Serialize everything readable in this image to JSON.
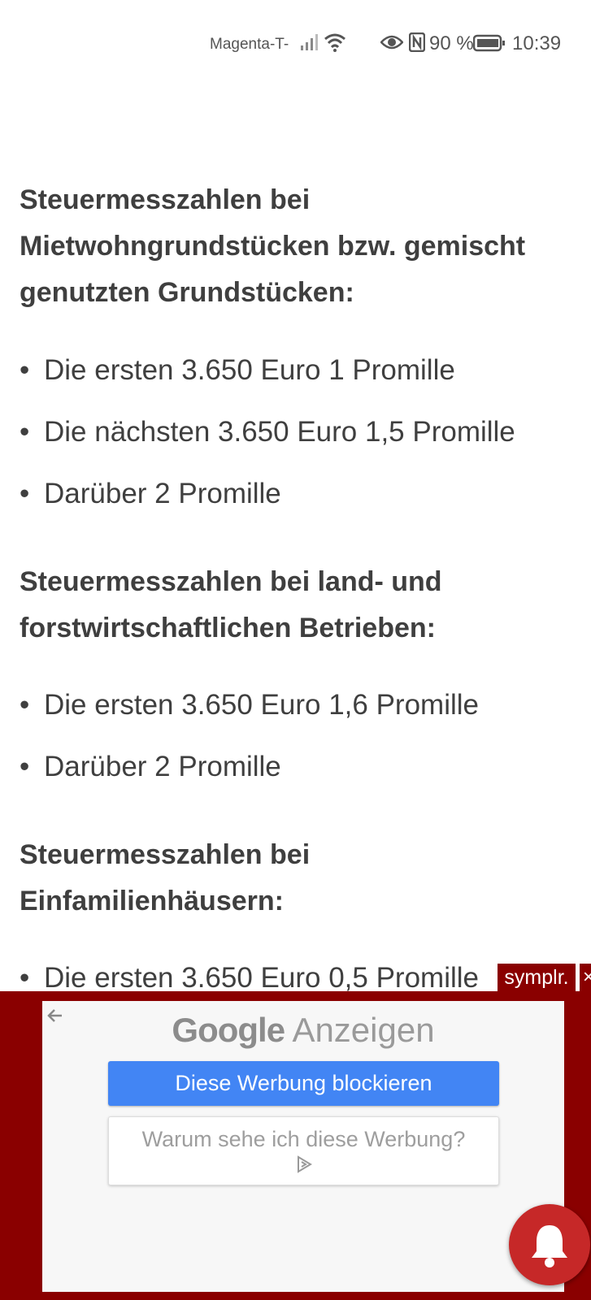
{
  "status_bar": {
    "carrier": "Magenta-T-",
    "battery_percent": "90 %",
    "time": "10:39",
    "icons": [
      "signal-icon",
      "wifi-icon",
      "eye-icon",
      "nfc-icon",
      "battery-icon"
    ]
  },
  "article": {
    "sections": [
      {
        "heading": "Steuermesszahlen bei Mietwohngrundstücken bzw. gemischt genutzten Grundstücken:",
        "items": [
          "Die ersten 3.650 Euro 1 Promille",
          "Die nächsten 3.650 Euro 1,5 Promille",
          "Darüber 2 Promille"
        ]
      },
      {
        "heading": "Steuermesszahlen bei land- und forstwirtschaftlichen Betrieben:",
        "items": [
          "Die ersten 3.650 Euro 1,6 Promille",
          "Darüber 2 Promille"
        ]
      },
      {
        "heading": "Steuermesszahlen bei Einfamilienhäusern:",
        "items": [
          "Die ersten 3.650 Euro 0,5 Promille"
        ]
      }
    ]
  },
  "ad": {
    "brand_google": "Google",
    "brand_suffix": "Anzeigen",
    "block_button": "Diese Werbung blockieren",
    "why_button": "Warum sehe ich diese Werbung?",
    "symplr_label": "symplr.",
    "symplr_close": "×",
    "background_color": "#8a0000",
    "button_color": "#4285f4"
  },
  "notification_button": {
    "icon": "bell-icon",
    "color": "#c62828"
  }
}
